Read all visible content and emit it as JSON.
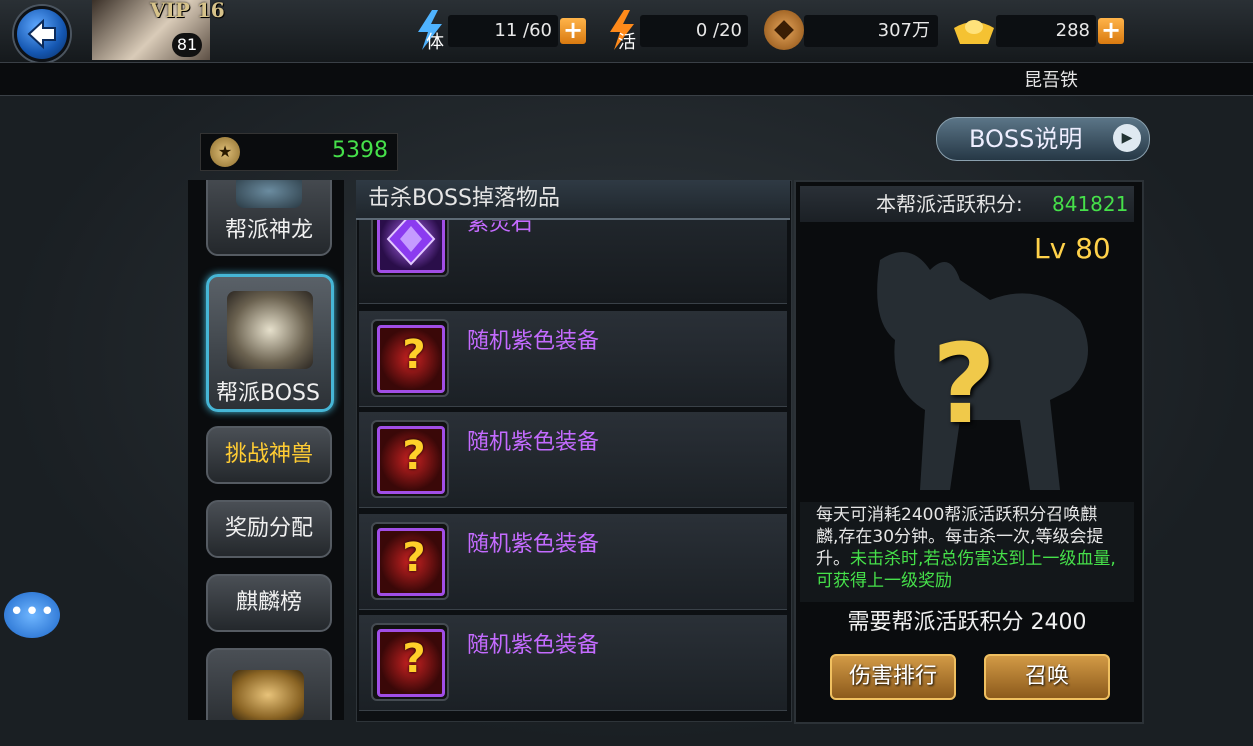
{
  "header": {
    "vip": "VIP 16",
    "level": "81",
    "player_name": "昆吾铁",
    "stamina": {
      "icon_label": "体",
      "value": "11 /60"
    },
    "energy": {
      "icon_label": "活",
      "value": "0 /20"
    },
    "coins": {
      "value": "307万"
    },
    "gold": {
      "value": "288"
    },
    "plus": "+"
  },
  "points": {
    "value": "5398"
  },
  "boss_info_button": {
    "label": "BOSS说明"
  },
  "nav": {
    "items": [
      {
        "label": "帮派神龙"
      },
      {
        "label": "帮派BOSS"
      },
      {
        "label": "挑战神兽"
      },
      {
        "label": "奖励分配"
      },
      {
        "label": "麒麟榜"
      }
    ]
  },
  "drops": {
    "title": "击杀BOSS掉落物品",
    "items": [
      {
        "name": "紫灵石"
      },
      {
        "name": "随机紫色装备"
      },
      {
        "name": "随机紫色装备"
      },
      {
        "name": "随机紫色装备"
      },
      {
        "name": "随机紫色装备"
      }
    ]
  },
  "boss": {
    "score_label": "本帮派活跃积分:",
    "score_value": "841821",
    "level": "Lv 80",
    "desc_white": "每天可消耗2400帮派活跃积分召唤麒麟,存在30分钟。每击杀一次,等级会提升。",
    "desc_green": "未击杀时,若总伤害达到上一级血量,可获得上一级奖励",
    "need": "需要帮派活跃积分 2400",
    "damage_rank_button": "伤害排行",
    "summon_button": "召唤"
  },
  "colors": {
    "accent_green": "#46e04a",
    "purple_text": "#c46bff",
    "gold": "#ffd24a"
  }
}
